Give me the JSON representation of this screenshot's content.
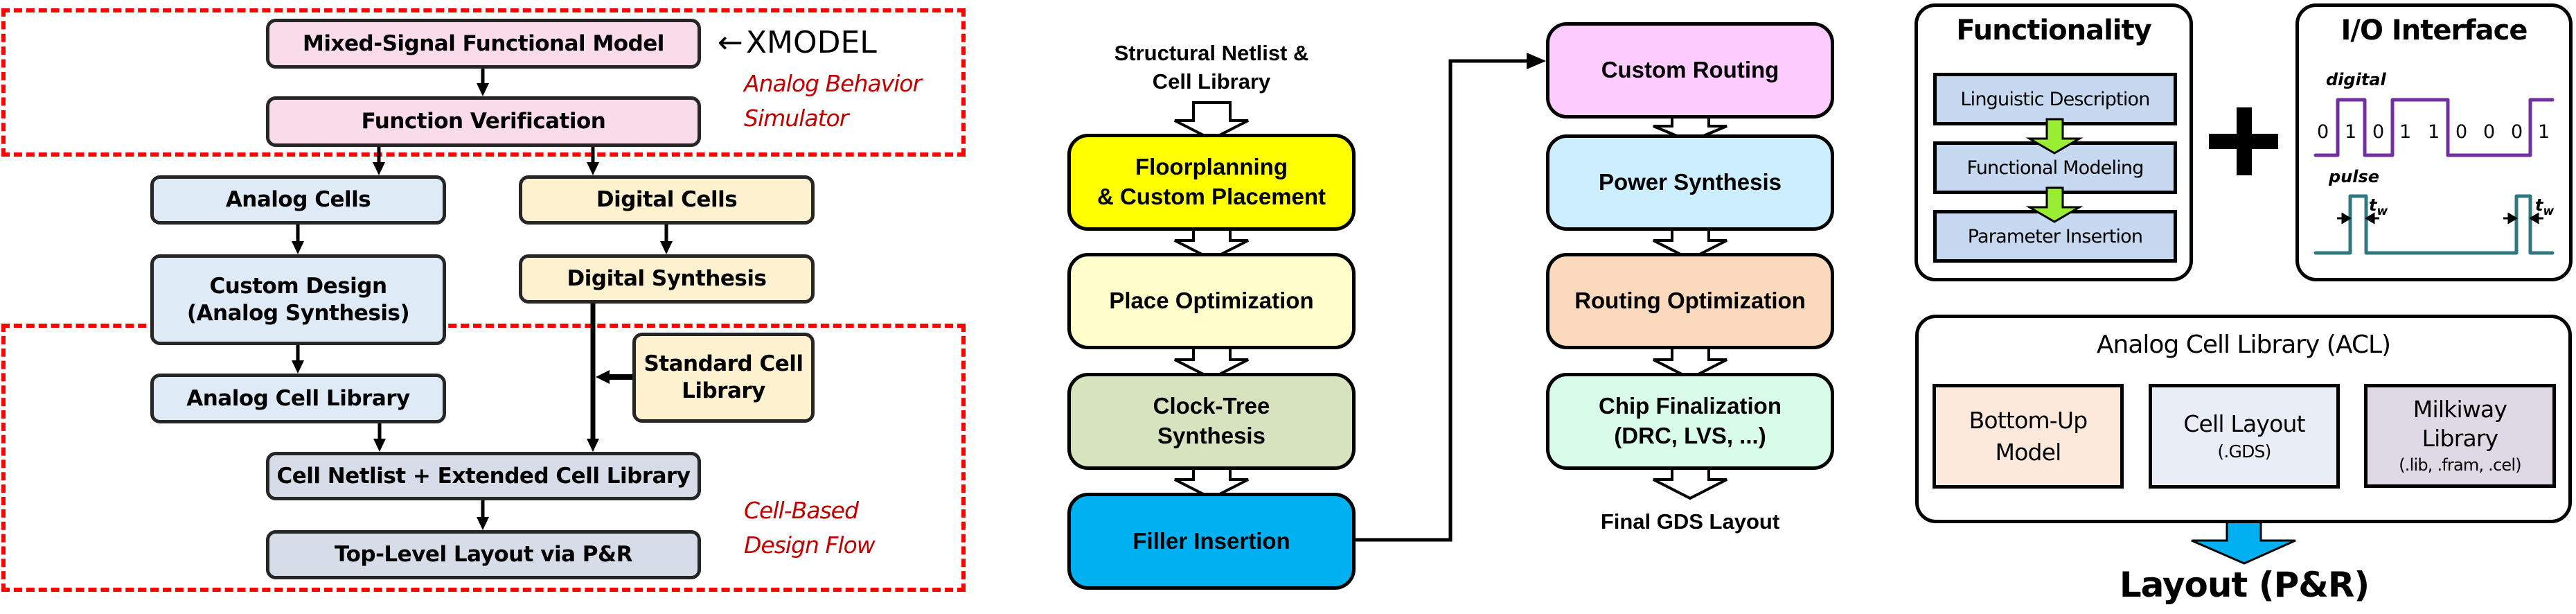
{
  "left_panel": {
    "xmodel_label": "XMODEL",
    "xmodel_arrow": "←",
    "region_top_label": [
      "Analog Behavior",
      "Simulator"
    ],
    "region_bottom_label": [
      "Cell-Based",
      "Design Flow"
    ],
    "boxes": {
      "mixed_signal_model": "Mixed-Signal Functional Model",
      "function_verification": "Function Verification",
      "analog_cells": "Analog Cells",
      "digital_cells": "Digital Cells",
      "custom_design": [
        "Custom Design",
        "(Analog Synthesis)"
      ],
      "digital_synthesis": "Digital Synthesis",
      "standard_cell_library": [
        "Standard Cell",
        "Library"
      ],
      "analog_cell_library": "Analog Cell Library",
      "cell_netlist": "Cell Netlist + Extended Cell Library",
      "top_level_layout": "Top-Level Layout via P&R"
    },
    "colors": {
      "pink": "#fadbe9",
      "analog_blue": "#deeaf6",
      "digital_yellow": "#fdf1cf",
      "netlist_grey": "#d6dde8",
      "dashed_region": "#ff0000",
      "region_label": "#c00000"
    }
  },
  "middle_panel": {
    "input_label": [
      "Structural Netlist &",
      "Cell Library"
    ],
    "output_label": "Final GDS Layout",
    "left_column": [
      {
        "label": [
          "Floorplanning",
          "& Custom Placement"
        ],
        "color": "#ffff00"
      },
      {
        "label": [
          "Place Optimization"
        ],
        "color": "#ffffcc"
      },
      {
        "label": [
          "Clock-Tree",
          "Synthesis"
        ],
        "color": "#d7e3bf"
      },
      {
        "label": [
          "Filler Insertion"
        ],
        "color": "#00b0f0"
      }
    ],
    "right_column": [
      {
        "label": [
          "Custom Routing"
        ],
        "color": "#ffccff"
      },
      {
        "label": [
          "Power Synthesis"
        ],
        "color": "#cceeff"
      },
      {
        "label": [
          "Routing Optimization"
        ],
        "color": "#fad9bc"
      },
      {
        "label": [
          "Chip Finalization",
          "(DRC, LVS, ...)"
        ],
        "color": "#d9fbe9"
      }
    ]
  },
  "right_panel": {
    "functionality": {
      "title": "Functionality",
      "steps": [
        "Linguistic Description",
        "Functional Modeling",
        "Parameter Insertion"
      ],
      "step_color": "#c6d9f0",
      "arrow_color": "#99ee33"
    },
    "plus_symbol": "+",
    "io_interface": {
      "title": "I/O Interface",
      "digital_label": "digital",
      "digital_bits": [
        "0",
        "1",
        "0",
        "1",
        "1",
        "0",
        "0",
        "0",
        "1"
      ],
      "digital_color": "#7030a0",
      "pulse_label": "pulse",
      "pulse_width_label": "t",
      "pulse_width_subscript": "w",
      "pulse_color": "#31777f"
    },
    "acl": {
      "title": "Analog Cell Library (ACL)",
      "items": [
        {
          "lines": [
            "Bottom-Up",
            "Model"
          ],
          "sub": "",
          "color": "#fde9dc"
        },
        {
          "lines": [
            "Cell Layout"
          ],
          "sub": "(.GDS)",
          "color": "#e9eef6"
        },
        {
          "lines": [
            "Milkiway",
            "Library"
          ],
          "sub": "(.lib, .fram, .cel)",
          "color": "#dfd9e6"
        }
      ]
    },
    "output_arrow_color": "#00b0f0",
    "output_label": "Layout (P&R)"
  }
}
